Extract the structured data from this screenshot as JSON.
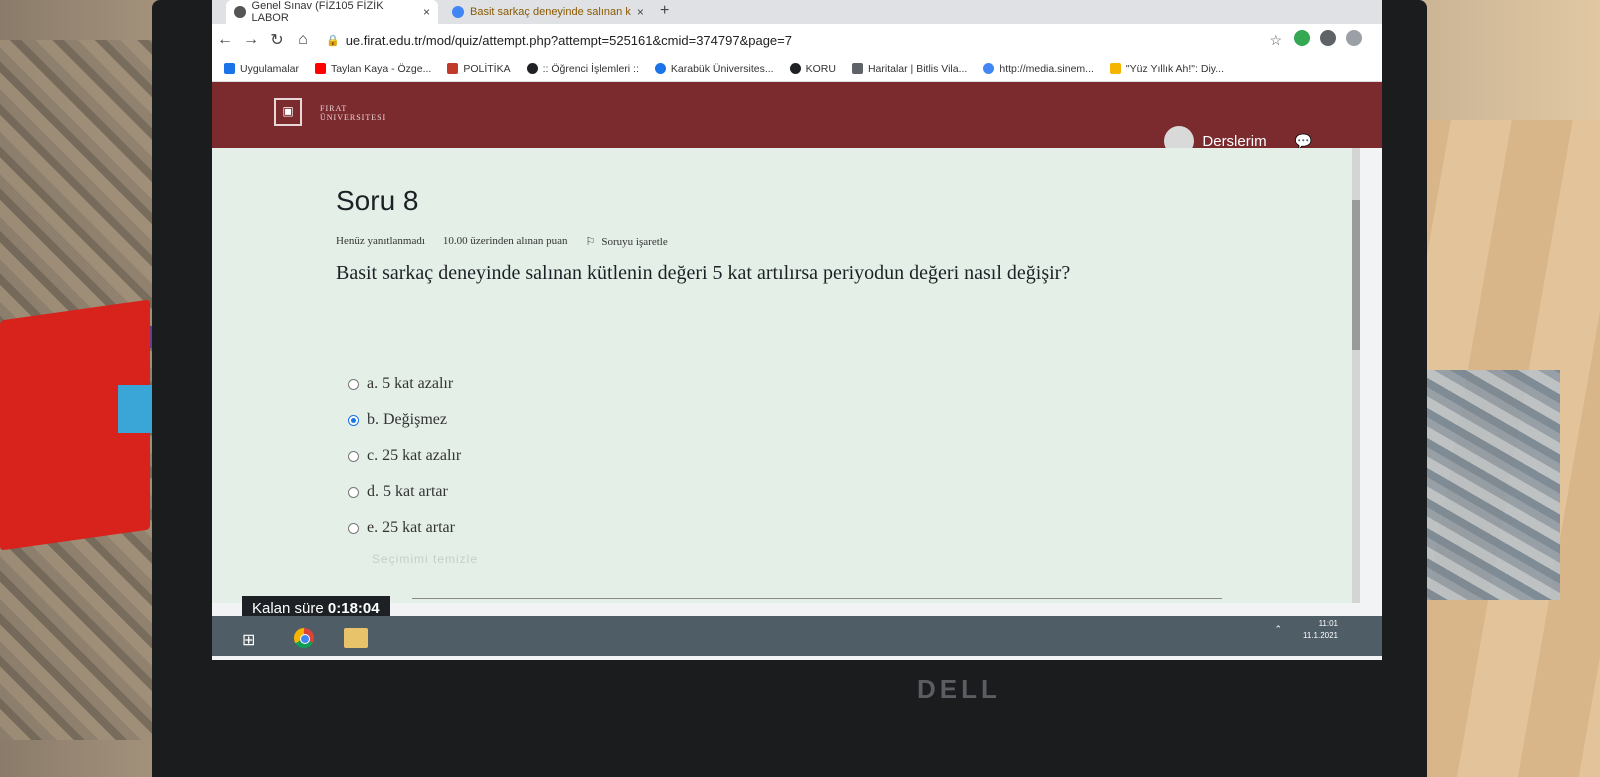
{
  "browser": {
    "tabs": [
      {
        "label": "Genel Sınav (FİZ105 FİZİK LABOR",
        "active": true
      },
      {
        "label": "Basit sarkaç deneyinde salınan k",
        "active": false
      }
    ],
    "new_tab": "+",
    "close": "×",
    "url": "ue.firat.edu.tr/mod/quiz/attempt.php?attempt=525161&cmid=374797&page=7",
    "bookmarks": [
      {
        "label": "Uygulamalar",
        "color": "#1a73e8"
      },
      {
        "label": "Taylan Kaya - Özge...",
        "color": "#ff0000"
      },
      {
        "label": "POLİTİKA",
        "color": "#c0392b"
      },
      {
        "label": ":: Öğrenci İşlemleri ::",
        "color": "#202124"
      },
      {
        "label": "Karabük Üniversites...",
        "color": "#1a73e8"
      },
      {
        "label": "KORU",
        "color": "#202124"
      },
      {
        "label": "Haritalar | Bitlis Vila...",
        "color": "#5f6368"
      },
      {
        "label": "http://media.sinem...",
        "color": "#4285f4"
      },
      {
        "label": "\"Yüz Yıllık Ah!\": Diy...",
        "color": "#f4b400"
      }
    ]
  },
  "header": {
    "logo_line1": "FIRAT",
    "logo_line2": "ÜNIVERSITESI",
    "menu_label": "Derslerim"
  },
  "question": {
    "title": "Soru 8",
    "status": "Henüz yanıtlanmadı",
    "points": "10.00 üzerinden alınan puan",
    "flag_label": "Soruyu işaretle",
    "text": "Basit sarkaç deneyinde salınan kütlenin değeri 5 kat artılırsa periyodun değeri nasıl değişir?",
    "answers": [
      {
        "label": "a. 5 kat azalır",
        "selected": false
      },
      {
        "label": "b. Değişmez",
        "selected": true
      },
      {
        "label": "c. 25 kat azalır",
        "selected": false
      },
      {
        "label": "d. 5 kat artar",
        "selected": false
      },
      {
        "label": "e. 25 kat artar",
        "selected": false
      }
    ],
    "clear_label": "Seçimimi temizle"
  },
  "timer": {
    "label": "Kalan süre",
    "value": "0:18:04"
  },
  "taskbar": {
    "time": "11:01",
    "date": "11.1.2021"
  },
  "brand": "DELL"
}
